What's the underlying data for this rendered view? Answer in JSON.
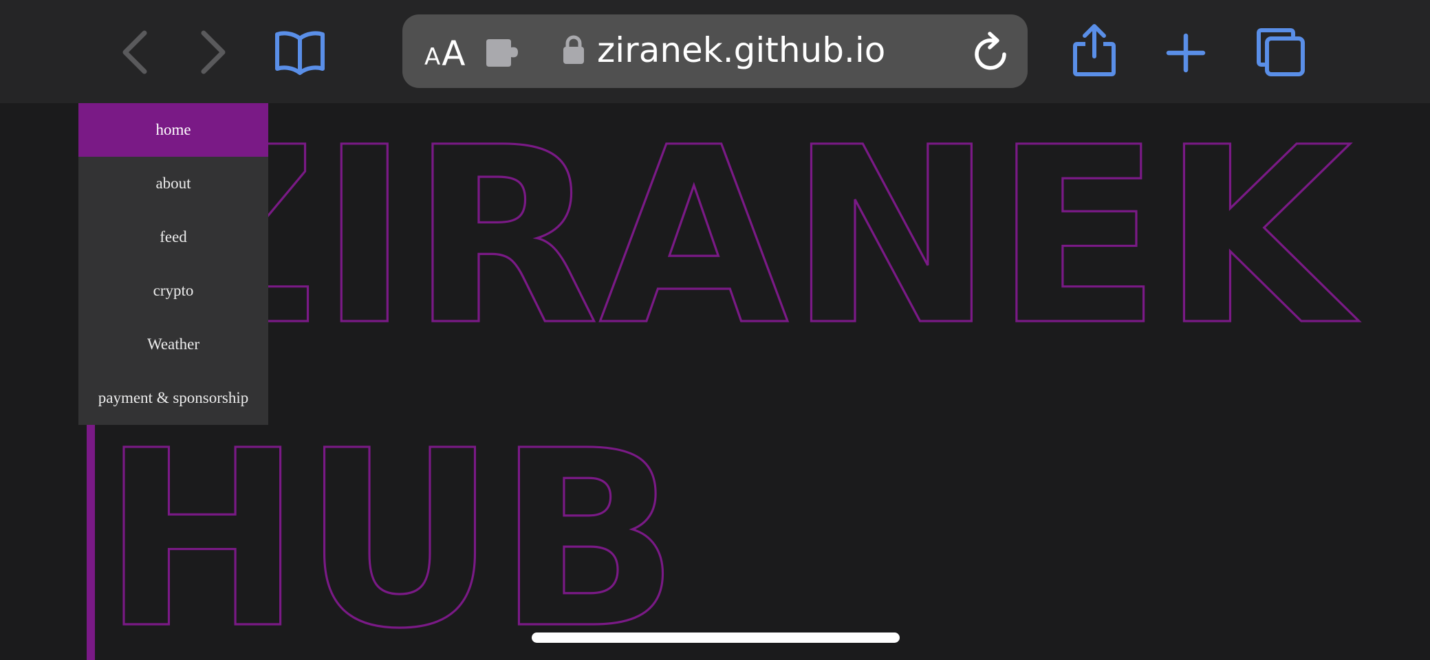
{
  "browser": {
    "text_size_small": "A",
    "text_size_large": "A",
    "url": "ziranek.github.io",
    "icons": {
      "back": "chevron-left-icon",
      "forward": "chevron-right-icon",
      "bookmarks": "book-icon",
      "extension": "puzzle-icon",
      "secure": "lock-icon",
      "reload": "reload-icon",
      "share": "share-icon",
      "new_tab": "plus-icon",
      "tabs": "tabs-icon"
    },
    "colors": {
      "accent": "#5a8fe8",
      "toolbar_bg": "#252526",
      "urlbar_bg": "#505050"
    }
  },
  "nav": {
    "items": [
      {
        "label": "home",
        "active": true
      },
      {
        "label": "about",
        "active": false
      },
      {
        "label": "feed",
        "active": false
      },
      {
        "label": "crypto",
        "active": false
      },
      {
        "label": "Weather",
        "active": false
      },
      {
        "label": "payment & sponsorship",
        "active": false
      }
    ]
  },
  "hero": {
    "line1": "ZIRANEK",
    "line2": "HUB",
    "outline_color": "#7a1a86"
  }
}
